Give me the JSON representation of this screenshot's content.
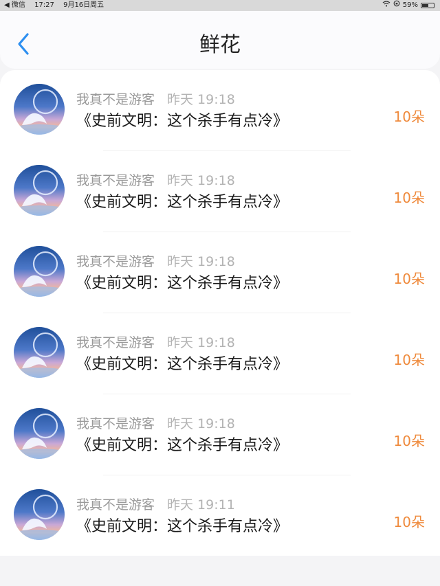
{
  "status_bar": {
    "back_app": "◀ 微信",
    "time": "17:27",
    "date": "9月16日周五",
    "battery": "59%",
    "battery_level": 0.59
  },
  "header": {
    "title": "鲜花"
  },
  "colors": {
    "accent_blue": "#2d8ff0",
    "count_orange": "#ef8a3c"
  },
  "gifts": [
    {
      "user": "我真不是游客",
      "time": "昨天 19:18",
      "book": "《史前文明：这个杀手有点冷》",
      "count": "10朵"
    },
    {
      "user": "我真不是游客",
      "time": "昨天 19:18",
      "book": "《史前文明：这个杀手有点冷》",
      "count": "10朵"
    },
    {
      "user": "我真不是游客",
      "time": "昨天 19:18",
      "book": "《史前文明：这个杀手有点冷》",
      "count": "10朵"
    },
    {
      "user": "我真不是游客",
      "time": "昨天 19:18",
      "book": "《史前文明：这个杀手有点冷》",
      "count": "10朵"
    },
    {
      "user": "我真不是游客",
      "time": "昨天 19:18",
      "book": "《史前文明：这个杀手有点冷》",
      "count": "10朵"
    },
    {
      "user": "我真不是游客",
      "time": "昨天 19:11",
      "book": "《史前文明：这个杀手有点冷》",
      "count": "10朵"
    }
  ]
}
